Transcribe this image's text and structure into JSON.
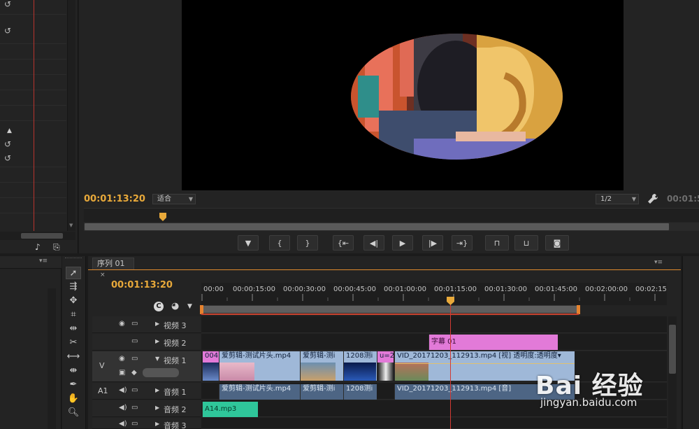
{
  "history_panel": {
    "undo_icons": [
      "undo-icon",
      "undo-icon",
      "undo-icon",
      "undo-icon"
    ]
  },
  "program_monitor": {
    "timecode": "00:01:13:20",
    "zoom_select": "适合",
    "resolution_select": "1/2",
    "timecode_right": "00:01:5",
    "transport_buttons": [
      "add-marker",
      "mark-in",
      "mark-out",
      "go-to-in",
      "step-back",
      "play",
      "step-forward",
      "go-to-out",
      "lift",
      "extract",
      "export-frame"
    ]
  },
  "timeline": {
    "tab_label": "序列 01",
    "timecode": "00:01:13:20",
    "ruler_labels": [
      "00:00",
      "00:00:15:00",
      "00:00:30:00",
      "00:00:45:00",
      "00:01:00:00",
      "00:01:15:00",
      "00:01:30:00",
      "00:01:45:00",
      "00:02:00:00",
      "00:02:15"
    ],
    "tracks": {
      "v3": "视频 3",
      "v2": "视频 2",
      "v1": "视频 1",
      "v_target": "V",
      "a1_target": "A1",
      "a1": "音频 1",
      "a2": "音频 2",
      "a3": "音频 3"
    },
    "clips": {
      "title_clip": "字幕 01",
      "v1_clip1": "004",
      "v1_clip2": "爱剪辑-测试片头.mp4",
      "v1_clip3": "爱剪辑-测i",
      "v1_clip4": "1208测i",
      "v1_clip5": "u=2",
      "v1_clip6": "VID_20171203_112913.mp4 [视] 透明度:透明度▾",
      "a1_clip2": "爱剪辑-测试片头.mp4",
      "a1_clip3": "爱剪辑-测i",
      "a1_clip4": "1208测i",
      "a1_clip6": "VID_20171203_112913.mp4 [音]",
      "a2_clip1": "A14.mp3"
    }
  },
  "watermark": {
    "logo": "Bai 经验",
    "url": "jingyan.baidu.com"
  },
  "colors": {
    "timecode": "#e8a93a",
    "playhead": "#d23a33",
    "video_clip": "#9fb8d8",
    "audio_clip": "#4d6584",
    "title_clip": "#e27ad8",
    "mp3_clip": "#2fc69a"
  }
}
